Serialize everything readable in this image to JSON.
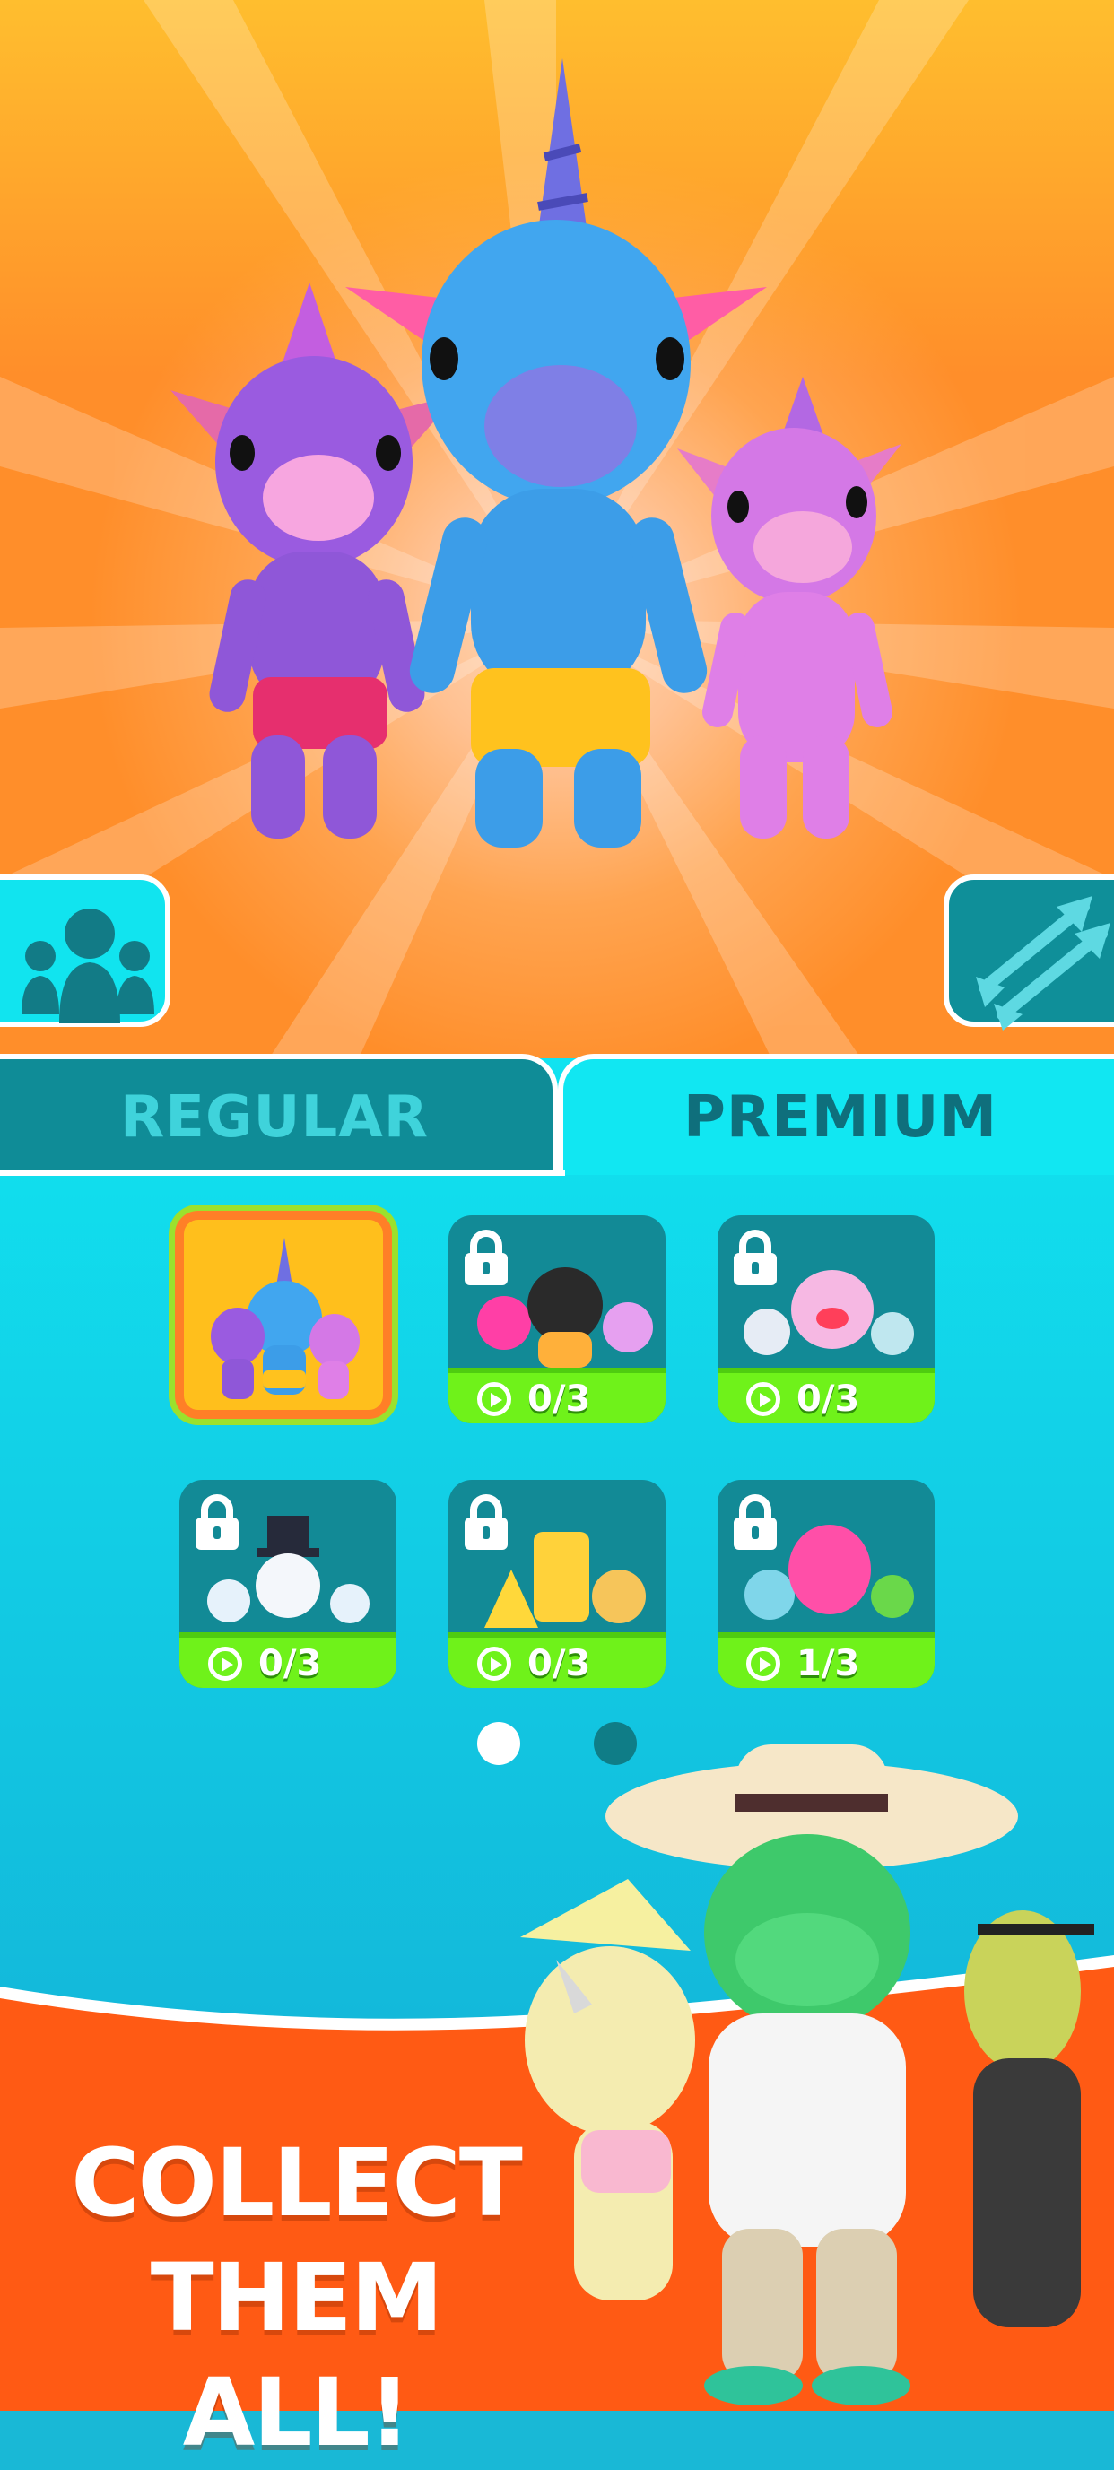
{
  "tabs": {
    "regular_label": "REGULAR",
    "premium_label": "PREMIUM",
    "active": "premium"
  },
  "buttons": {
    "team_icon": "group-icon",
    "arrows_icon": "arrows-icon"
  },
  "skin_packs": [
    {
      "name": "unicorn-pack",
      "locked": false,
      "selected": true,
      "progress": ""
    },
    {
      "name": "animals-pack",
      "locked": true,
      "selected": false,
      "progress": "0/3"
    },
    {
      "name": "fish-pack",
      "locked": true,
      "selected": false,
      "progress": "0/3"
    },
    {
      "name": "snowman-pack",
      "locked": true,
      "selected": false,
      "progress": "0/3"
    },
    {
      "name": "cheese-pack",
      "locked": true,
      "selected": false,
      "progress": "0/3"
    },
    {
      "name": "monsters-pack",
      "locked": true,
      "selected": false,
      "progress": "1/3"
    }
  ],
  "pagination": {
    "pages": 2,
    "current": 1
  },
  "promo": {
    "line1": "COLLECT",
    "line2": "THEM ALL!"
  },
  "colors": {
    "hero_orange": "#ff8e2a",
    "panel_cyan": "#11e3f0",
    "progress_green": "#6ff21a",
    "selected_gold": "#ffbf1c",
    "promo_orange": "#ff5a14"
  }
}
